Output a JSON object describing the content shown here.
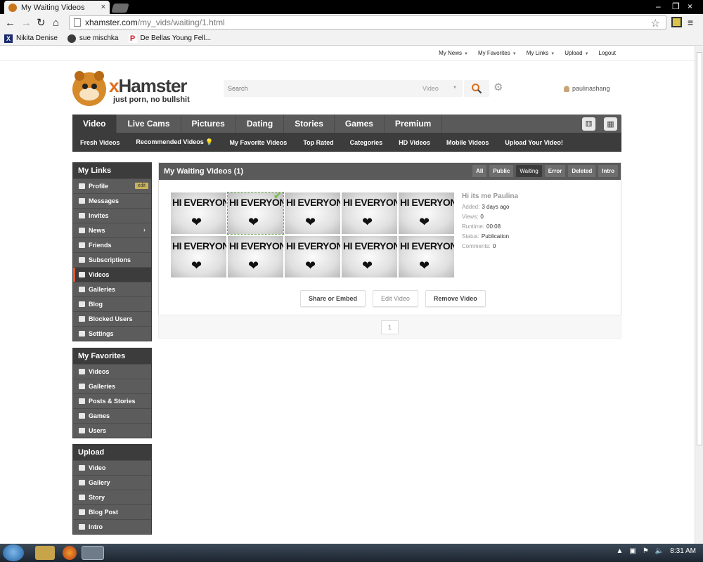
{
  "browser": {
    "tab_title": "My Waiting Videos",
    "close_glyph": "×",
    "url_host": "xhamster.com",
    "url_path": "/my_vids/waiting/1.html",
    "bookmarks": [
      {
        "label": "Nikita Denise",
        "icon_letter": "X",
        "icon_color": "#1a2a6c"
      },
      {
        "label": "sue mischka",
        "icon_letter": "",
        "icon_color": "#3a3a3a"
      },
      {
        "label": "De Bellas Young Fell...",
        "icon_letter": "P",
        "icon_color": "#c4161c"
      }
    ]
  },
  "top_links": [
    "My News",
    "My Favorites",
    "My Links",
    "Upload",
    "Logout"
  ],
  "header": {
    "brand_x": "x",
    "brand_rest": "Hamster",
    "tagline": "just porn, no bullshit",
    "search_placeholder": "Search",
    "search_scope": "Video",
    "username": "paulinashang"
  },
  "main_nav": {
    "tabs": [
      "Video",
      "Live Cams",
      "Pictures",
      "Dating",
      "Stories",
      "Games",
      "Premium"
    ],
    "active_tab": "Video",
    "sub_tabs": [
      "Fresh Videos",
      "Recommended Videos 💡",
      "My Favorite Videos",
      "Top Rated",
      "Categories",
      "HD Videos",
      "Mobile Videos",
      "Upload Your Video!"
    ]
  },
  "sidebar": {
    "my_links": {
      "title": "My Links",
      "edit_label": "edit",
      "items": [
        "Profile",
        "Messages",
        "Invites",
        "News",
        "Friends",
        "Subscriptions",
        "Videos",
        "Galleries",
        "Blog",
        "Blocked Users",
        "Settings"
      ],
      "active": "Videos"
    },
    "my_favorites": {
      "title": "My Favorites",
      "items": [
        "Videos",
        "Galleries",
        "Posts & Stories",
        "Games",
        "Users"
      ]
    },
    "upload": {
      "title": "Upload",
      "items": [
        "Video",
        "Gallery",
        "Story",
        "Blog Post",
        "Intro"
      ]
    }
  },
  "content": {
    "title": "My Waiting Videos (1)",
    "filters": [
      "All",
      "Public",
      "Waiting",
      "Error",
      "Deleted",
      "Intro"
    ],
    "active_filter": "Waiting",
    "thumb_text": "HI EVERYONE",
    "thumb_count": 10,
    "video": {
      "title": "Hi its me Paulina",
      "meta": [
        {
          "label": "Added:",
          "value": "3 days ago"
        },
        {
          "label": "Views:",
          "value": "0"
        },
        {
          "label": "Runtime:",
          "value": "00:08"
        },
        {
          "label": "Status:",
          "value": "Publication"
        },
        {
          "label": "Comments:",
          "value": "0"
        }
      ]
    },
    "actions": [
      "Share or Embed",
      "Edit Video",
      "Remove Video"
    ],
    "page": "1"
  },
  "taskbar": {
    "time": "8:31 AM"
  },
  "colors": {
    "nav_bg": "#5a5a5a",
    "nav_active": "#3c3c3c",
    "brand_orange": "#e06d1a",
    "active_marker": "#e4572e"
  }
}
